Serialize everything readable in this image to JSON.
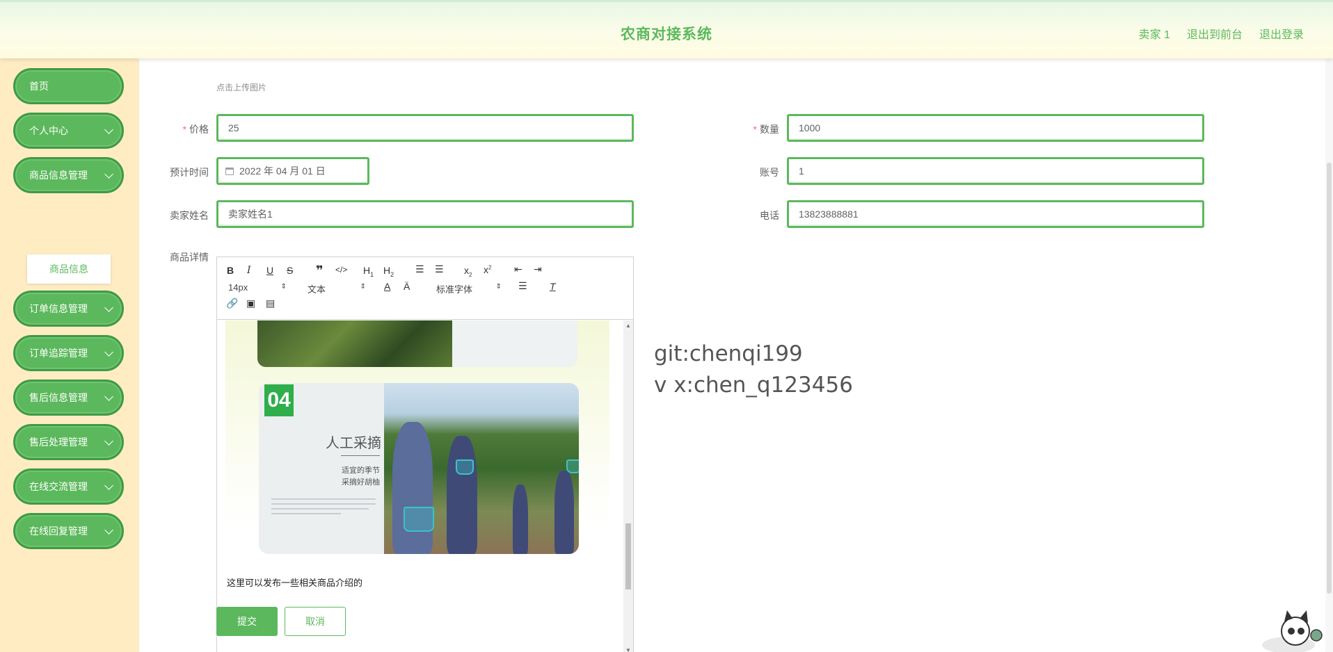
{
  "header": {
    "title": "农商对接系统",
    "user": "卖家 1",
    "to_front": "退出到前台",
    "logout": "退出登录"
  },
  "sidebar": {
    "items": [
      {
        "label": "首页"
      },
      {
        "label": "个人中心"
      },
      {
        "label": "商品信息管理"
      },
      {
        "label": "订单信息管理"
      },
      {
        "label": "订单追踪管理"
      },
      {
        "label": "售后信息管理"
      },
      {
        "label": "售后处理管理"
      },
      {
        "label": "在线交流管理"
      },
      {
        "label": "在线回复管理"
      }
    ],
    "submenu": {
      "label": "商品信息"
    }
  },
  "form": {
    "upload_hint": "点击上传图片",
    "price": {
      "label": "价格",
      "value": "25"
    },
    "quantity": {
      "label": "数量",
      "value": "1000"
    },
    "expected_time": {
      "label": "预计时间",
      "value": "2022 年 04 月 01 日"
    },
    "account": {
      "label": "账号",
      "value": "1"
    },
    "seller_name": {
      "label": "卖家姓名",
      "value": "卖家姓名1"
    },
    "phone": {
      "label": "电话",
      "value": "13823888881"
    },
    "detail": {
      "label": "商品详情"
    }
  },
  "editor": {
    "font_size": "14px",
    "header_select": "文本",
    "font_family": "标准字体",
    "content_text": "这里可以发布一些相关商品介绍的",
    "image": {
      "badge": "04",
      "title": "人工采摘",
      "subtitle_1": "适宜的季节",
      "subtitle_2": "采摘好胡柚"
    }
  },
  "watermark": {
    "line1": "git:chenqi199",
    "line2": "v x:chen_q123456"
  },
  "buttons": {
    "submit": "提交",
    "cancel": "取消"
  },
  "colors": {
    "accent": "#5cb85c",
    "sidebar_bg": "#ffecc3",
    "required": "#f56c6c"
  }
}
